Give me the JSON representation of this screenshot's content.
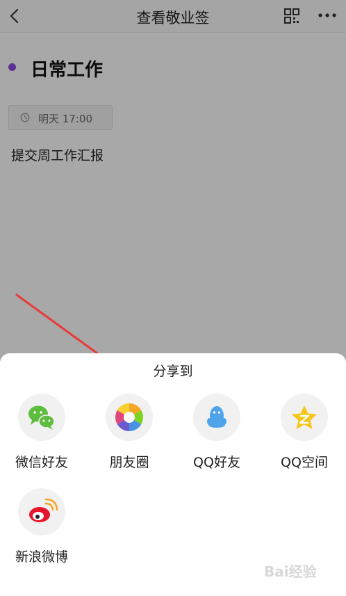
{
  "nav": {
    "title": "查看敬业签"
  },
  "note": {
    "category": "日常工作",
    "category_color": "#8d4be0",
    "reminder_time": "明天 17:00",
    "content": "提交周工作汇报"
  },
  "share_sheet": {
    "title": "分享到",
    "items": [
      {
        "label": "微信好友",
        "icon": "wechat-icon"
      },
      {
        "label": "朋友圈",
        "icon": "moments-icon"
      },
      {
        "label": "QQ好友",
        "icon": "qq-icon"
      },
      {
        "label": "QQ空间",
        "icon": "qzone-icon"
      },
      {
        "label": "新浪微博",
        "icon": "weibo-icon"
      }
    ]
  },
  "watermark": "Bai经验"
}
